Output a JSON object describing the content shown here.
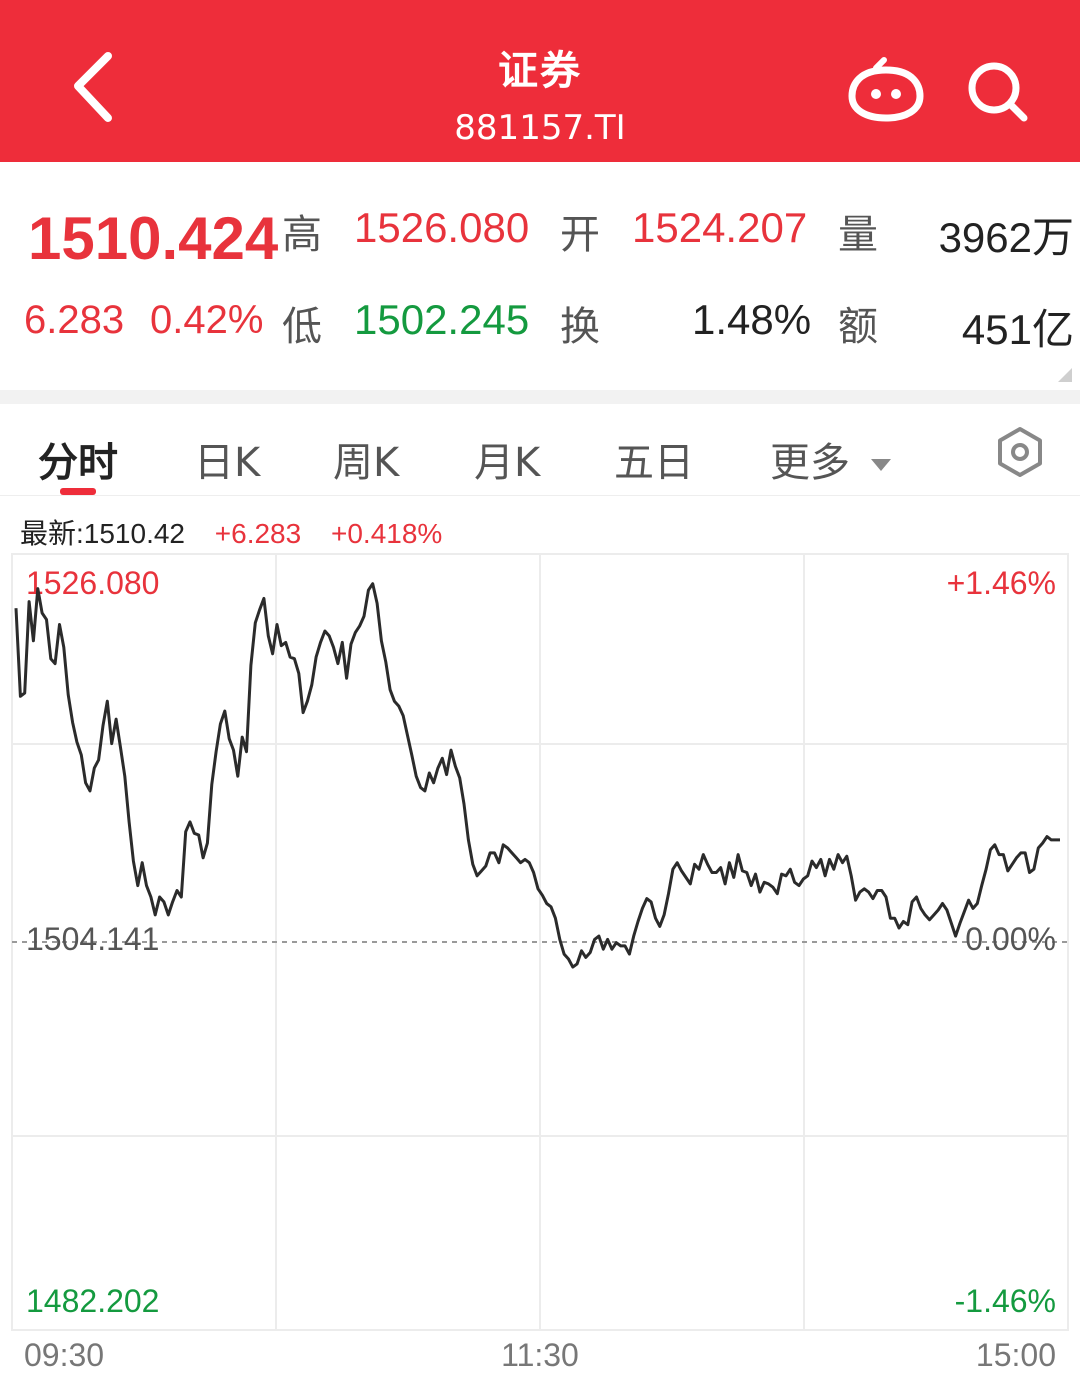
{
  "header": {
    "back_icon": "chevron-left-icon",
    "title": "证券",
    "code": "881157.TI",
    "robot_icon": "robot-assistant-icon",
    "search_icon": "search-icon",
    "bg_color": "#ee2d3a"
  },
  "quote": {
    "price": "1510.424",
    "change": "6.283",
    "change_pct": "0.42%",
    "high_label": "高",
    "high": "1526.080",
    "low_label": "低",
    "low": "1502.245",
    "open_label": "开",
    "open": "1524.207",
    "turnover_label": "换",
    "turnover": "1.48%",
    "volume_label": "量",
    "volume": "3962万",
    "amount_label": "额",
    "amount": "451亿"
  },
  "tabs": [
    {
      "label": "分时",
      "active": true
    },
    {
      "label": "日K"
    },
    {
      "label": "周K"
    },
    {
      "label": "月K"
    },
    {
      "label": "五日"
    },
    {
      "label": "更多"
    }
  ],
  "settings_icon": "hexagon-settings-icon",
  "latest_bar": {
    "latest_label": "最新:1510.42",
    "change": "+6.283",
    "change_pct": "+0.418%"
  },
  "chart_data": {
    "type": "line",
    "y_labels": {
      "top_left": "1526.080",
      "top_right": "+1.46%",
      "mid_left": "1504.141",
      "mid_right": "0.00%",
      "bottom_left": "1482.202",
      "bottom_right": "-1.46%"
    },
    "x_labels": [
      "09:30",
      "11:30",
      "15:00"
    ],
    "ylim": [
      1482.202,
      1526.08
    ],
    "prev_close": 1504.141,
    "x_range": [
      0,
      240
    ],
    "series": [
      {
        "values": [
          [
            0,
            1524.6
          ],
          [
            1,
            1519.2
          ],
          [
            2,
            1519.4
          ],
          [
            3,
            1525.0
          ],
          [
            4,
            1522.6
          ],
          [
            5,
            1525.8
          ],
          [
            6,
            1524.3
          ],
          [
            7,
            1523.9
          ],
          [
            8,
            1521.5
          ],
          [
            9,
            1521.2
          ],
          [
            10,
            1523.6
          ],
          [
            11,
            1522.2
          ],
          [
            12,
            1519.3
          ],
          [
            13,
            1517.6
          ],
          [
            14,
            1516.4
          ],
          [
            15,
            1515.6
          ],
          [
            16,
            1513.9
          ],
          [
            17,
            1513.4
          ],
          [
            18,
            1514.8
          ],
          [
            19,
            1515.3
          ],
          [
            20,
            1517.4
          ],
          [
            21,
            1518.9
          ],
          [
            22,
            1516.3
          ],
          [
            23,
            1517.8
          ],
          [
            24,
            1516.1
          ],
          [
            25,
            1514.3
          ],
          [
            26,
            1511.5
          ],
          [
            27,
            1509.1
          ],
          [
            28,
            1507.6
          ],
          [
            29,
            1509.0
          ],
          [
            30,
            1507.6
          ],
          [
            31,
            1506.9
          ],
          [
            32,
            1505.8
          ],
          [
            33,
            1506.9
          ],
          [
            34,
            1506.6
          ],
          [
            35,
            1505.8
          ],
          [
            36,
            1506.6
          ],
          [
            37,
            1507.3
          ],
          [
            38,
            1506.9
          ],
          [
            39,
            1510.9
          ],
          [
            40,
            1511.5
          ],
          [
            41,
            1510.8
          ],
          [
            42,
            1510.7
          ],
          [
            43,
            1509.3
          ],
          [
            44,
            1510.2
          ],
          [
            45,
            1513.8
          ],
          [
            46,
            1515.8
          ],
          [
            47,
            1517.5
          ],
          [
            48,
            1518.3
          ],
          [
            49,
            1516.6
          ],
          [
            50,
            1515.9
          ],
          [
            51,
            1514.3
          ],
          [
            52,
            1516.7
          ],
          [
            53,
            1515.8
          ],
          [
            54,
            1521.1
          ],
          [
            55,
            1523.7
          ],
          [
            56,
            1524.5
          ],
          [
            57,
            1525.2
          ],
          [
            58,
            1522.9
          ],
          [
            59,
            1521.8
          ],
          [
            60,
            1523.6
          ],
          [
            61,
            1522.3
          ],
          [
            62,
            1522.5
          ],
          [
            63,
            1521.6
          ],
          [
            64,
            1521.5
          ],
          [
            65,
            1520.6
          ],
          [
            66,
            1518.2
          ],
          [
            67,
            1518.9
          ],
          [
            68,
            1519.9
          ],
          [
            69,
            1521.6
          ],
          [
            70,
            1522.5
          ],
          [
            71,
            1523.2
          ],
          [
            72,
            1522.9
          ],
          [
            73,
            1522.2
          ],
          [
            74,
            1521.2
          ],
          [
            75,
            1522.5
          ],
          [
            76,
            1520.3
          ],
          [
            77,
            1522.4
          ],
          [
            78,
            1523.1
          ],
          [
            79,
            1523.5
          ],
          [
            80,
            1524.1
          ],
          [
            81,
            1525.7
          ],
          [
            82,
            1526.1
          ],
          [
            83,
            1524.9
          ],
          [
            84,
            1522.6
          ],
          [
            85,
            1521.3
          ],
          [
            86,
            1519.6
          ],
          [
            87,
            1518.9
          ],
          [
            88,
            1518.6
          ],
          [
            89,
            1518.0
          ],
          [
            90,
            1516.8
          ],
          [
            91,
            1515.6
          ],
          [
            92,
            1514.3
          ],
          [
            93,
            1513.6
          ],
          [
            94,
            1513.4
          ],
          [
            95,
            1514.5
          ],
          [
            96,
            1513.9
          ],
          [
            97,
            1514.8
          ],
          [
            98,
            1515.4
          ],
          [
            99,
            1514.4
          ],
          [
            100,
            1515.9
          ],
          [
            101,
            1514.9
          ],
          [
            102,
            1514.2
          ],
          [
            103,
            1512.6
          ],
          [
            104,
            1510.4
          ],
          [
            105,
            1508.9
          ],
          [
            106,
            1508.2
          ],
          [
            107,
            1508.5
          ],
          [
            108,
            1508.8
          ],
          [
            109,
            1509.6
          ],
          [
            110,
            1509.6
          ],
          [
            111,
            1509.0
          ],
          [
            112,
            1510.1
          ],
          [
            113,
            1509.9
          ],
          [
            114,
            1509.6
          ],
          [
            115,
            1509.3
          ],
          [
            116,
            1509.0
          ],
          [
            117,
            1509.2
          ],
          [
            118,
            1509.0
          ],
          [
            119,
            1508.4
          ],
          [
            120,
            1507.4
          ],
          [
            121,
            1507.0
          ],
          [
            122,
            1506.5
          ],
          [
            123,
            1506.3
          ],
          [
            124,
            1505.6
          ],
          [
            125,
            1504.3
          ],
          [
            126,
            1503.4
          ],
          [
            127,
            1503.1
          ],
          [
            128,
            1502.6
          ],
          [
            129,
            1502.8
          ],
          [
            130,
            1503.6
          ],
          [
            131,
            1503.2
          ],
          [
            132,
            1503.5
          ],
          [
            133,
            1504.3
          ],
          [
            134,
            1504.5
          ],
          [
            135,
            1503.7
          ],
          [
            136,
            1504.3
          ],
          [
            137,
            1503.7
          ],
          [
            138,
            1504.1
          ],
          [
            139,
            1503.9
          ],
          [
            140,
            1503.9
          ],
          [
            141,
            1503.4
          ],
          [
            142,
            1504.5
          ],
          [
            143,
            1505.4
          ],
          [
            144,
            1506.2
          ],
          [
            145,
            1506.8
          ],
          [
            146,
            1506.6
          ],
          [
            147,
            1505.6
          ],
          [
            148,
            1505.1
          ],
          [
            149,
            1505.8
          ],
          [
            150,
            1507.1
          ],
          [
            151,
            1508.6
          ],
          [
            152,
            1509.0
          ],
          [
            153,
            1508.5
          ],
          [
            154,
            1508.1
          ],
          [
            155,
            1507.7
          ],
          [
            156,
            1508.9
          ],
          [
            157,
            1508.6
          ],
          [
            158,
            1509.5
          ],
          [
            159,
            1508.9
          ],
          [
            160,
            1508.4
          ],
          [
            161,
            1508.4
          ],
          [
            162,
            1508.7
          ],
          [
            163,
            1507.7
          ],
          [
            164,
            1509.0
          ],
          [
            165,
            1508.1
          ],
          [
            166,
            1509.5
          ],
          [
            167,
            1508.5
          ],
          [
            168,
            1508.4
          ],
          [
            169,
            1507.6
          ],
          [
            170,
            1508.3
          ],
          [
            171,
            1507.2
          ],
          [
            172,
            1507.8
          ],
          [
            173,
            1507.7
          ],
          [
            174,
            1507.5
          ],
          [
            175,
            1507.1
          ],
          [
            176,
            1508.3
          ],
          [
            177,
            1508.2
          ],
          [
            178,
            1508.6
          ],
          [
            179,
            1507.8
          ],
          [
            180,
            1507.6
          ],
          [
            181,
            1508.0
          ],
          [
            182,
            1508.2
          ],
          [
            183,
            1509.1
          ],
          [
            184,
            1508.7
          ],
          [
            185,
            1509.2
          ],
          [
            186,
            1508.2
          ],
          [
            187,
            1509.2
          ],
          [
            188,
            1508.6
          ],
          [
            189,
            1509.5
          ],
          [
            190,
            1509.0
          ],
          [
            191,
            1509.4
          ],
          [
            192,
            1508.2
          ],
          [
            193,
            1506.7
          ],
          [
            194,
            1507.2
          ],
          [
            195,
            1507.4
          ],
          [
            196,
            1507.2
          ],
          [
            197,
            1506.8
          ],
          [
            198,
            1507.3
          ],
          [
            199,
            1507.3
          ],
          [
            200,
            1506.9
          ],
          [
            201,
            1505.6
          ],
          [
            202,
            1505.6
          ],
          [
            203,
            1505.0
          ],
          [
            204,
            1505.4
          ],
          [
            205,
            1505.2
          ],
          [
            206,
            1506.6
          ],
          [
            207,
            1506.9
          ],
          [
            208,
            1506.2
          ],
          [
            209,
            1505.8
          ],
          [
            210,
            1505.5
          ],
          [
            211,
            1505.8
          ],
          [
            212,
            1506.1
          ],
          [
            213,
            1506.5
          ],
          [
            214,
            1506.1
          ],
          [
            215,
            1505.3
          ],
          [
            216,
            1504.5
          ],
          [
            217,
            1505.3
          ],
          [
            218,
            1506.0
          ],
          [
            219,
            1506.7
          ],
          [
            220,
            1506.2
          ],
          [
            221,
            1506.5
          ],
          [
            222,
            1507.6
          ],
          [
            223,
            1508.6
          ],
          [
            224,
            1509.8
          ],
          [
            225,
            1510.1
          ],
          [
            226,
            1509.5
          ],
          [
            227,
            1509.5
          ],
          [
            228,
            1508.5
          ],
          [
            229,
            1508.9
          ],
          [
            230,
            1509.3
          ],
          [
            231,
            1509.6
          ],
          [
            232,
            1509.6
          ],
          [
            233,
            1508.4
          ],
          [
            234,
            1508.6
          ],
          [
            235,
            1509.9
          ],
          [
            236,
            1510.2
          ],
          [
            237,
            1510.6
          ],
          [
            238,
            1510.4
          ],
          [
            239,
            1510.4
          ],
          [
            240,
            1510.4
          ]
        ]
      }
    ]
  }
}
